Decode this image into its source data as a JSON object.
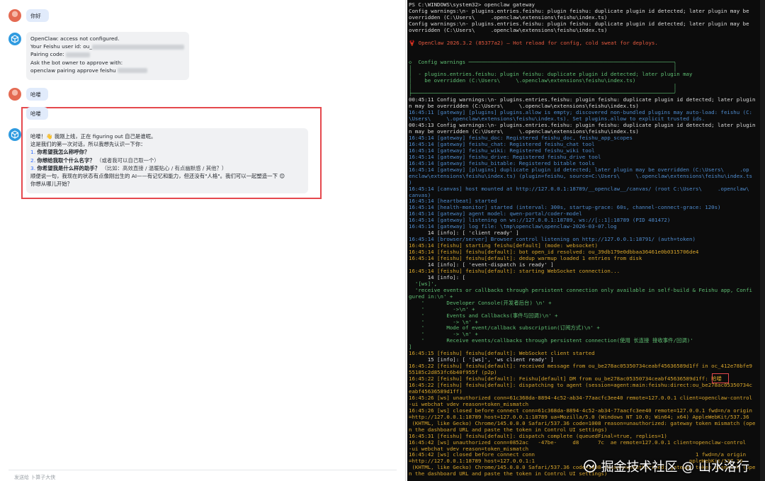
{
  "chat": {
    "messages": [
      {
        "role": "user",
        "text": "你好"
      },
      {
        "role": "bot",
        "lines": [
          "OpenClaw: access not configured.",
          "Your Feishu user id: ou_",
          "Pairing code:",
          "Ask the bot owner to approve with:",
          "openclaw pairing approve feishu"
        ]
      },
      {
        "role": "user",
        "text": "哈喽"
      },
      {
        "role": "user",
        "text": "哈喽"
      },
      {
        "role": "bot",
        "intro": "哈喽！👋 我刚上线，正在 figuring out 自己是谁呢。",
        "intro2": "这是我们的第一次对话，所以我想先认识一下你：",
        "items": [
          {
            "num": "1.",
            "bold": "你希望我怎么称呼你？",
            "sub": ""
          },
          {
            "num": "2.",
            "bold": "你想给我取个什么名字？",
            "sub": "（或者我可以自己取一个）"
          },
          {
            "num": "3.",
            "bold": "你希望我是什么样的助手？",
            "sub": "（比如：高效直接 / 温暖贴心 / 有点幽默感 / 其他？）"
          }
        ],
        "outro": "顺便说一句，我现在的状态有点像刚出生的 AI——有记忆和能力，但还没有\"人格\"。我们可以一起塑造一下 😊",
        "outro2": "你想从哪儿开始？"
      }
    ],
    "composer_placeholder": "发送给 卜算子大侠"
  },
  "terminal": {
    "lines": [
      "PS C:\\WINDOWS\\system32> openclaw gateway",
      "Config warnings:\\n- plugins.entries.feishu: plugin feishu: duplicate plugin id detected; later plugin may be",
      "overridden (C:\\Users\\     .openclaw\\extensions\\feishu\\index.ts)",
      "Config warnings:\\n- plugins.entries.feishu: plugin feishu: duplicate plugin id detected; later plugin may be",
      "overridden (C:\\Users\\     .openclaw\\extensions\\feishu\\index.ts)",
      "",
      "🦞 OpenClaw 2026.3.2 (85377a2) — Hot reload for config, cold sweat for deploys.",
      "",
      "",
      "◇  Config warnings ─────────────────────────────────────────────────────────────────╮",
      "│                                                                                   │",
      "│  - plugins.entries.feishu: plugin feishu: duplicate plugin id detected; later plugin may",
      "│    be overridden (C:\\Users\\     \\.openclaw\\extensions\\feishu\\index.ts)",
      "│                                                                                   │",
      "├───────────────────────────────────────────────────────────────────────────────────╯",
      "00:45:11 Config warnings:\\n- plugins.entries.feishu: plugin feishu: duplicate plugin id detected; later plugin",
      "n may be overridden (C:\\Users\\     \\.openclaw\\extensions\\feishu\\index.ts)",
      "16:45:11 [gateway] [plugins] plugins.allow is empty; discovered non-bundled plugins may auto-load: feishu (C:",
      "\\Users\\     \\.openclaw\\extensions\\feishu\\index.ts). Set plugins.allow to explicit trusted ids.",
      "00:45:13 Config warnings:\\n- plugins.entries.feishu: plugin feishu: duplicate plugin id detected; later plugin",
      "n may be overridden (C:\\Users\\     \\.openclaw\\extensions\\feishu\\index.ts)",
      "16:45:14 [gateway] feishu_doc: Registered feishu_doc, feishu_app_scopes",
      "16:45:14 [gateway] feishu_chat: Registered feishu_chat tool",
      "16:45:14 [gateway] feishu_wiki: Registered feishu_wiki tool",
      "16:45:14 [gateway] feishu_drive: Registered feishu_drive tool",
      "16:45:14 [gateway] feishu_bitable: Registered bitable tools",
      "16:45:14 [gateway] [plugins] duplicate plugin id detected; later plugin may be overridden (C:\\Users\\     .op",
      "enclaw\\extensions\\feishu\\index.ts) (plugin=feishu, source=C:\\Users\\     \\.openclaw\\extensions\\feishu\\index.ts",
      ")",
      "16:45:14 [canvas] host mounted at http://127.0.0.1:18789/__openclaw__/canvas/ (root C:\\Users\\     .openclaw\\",
      "canvas)",
      "16:45:14 [heartbeat] started",
      "16:45:14 [health-monitor] started (interval: 300s, startup-grace: 60s, channel-connect-grace: 120s)",
      "16:45:14 [gateway] agent model: qwen-portal/coder-model",
      "16:45:14 [gateway] listening on ws://127.0.0.1:18789, ws://[::1]:18789 (PID 481472)",
      "16:45:14 [gateway] log file: \\tmp\\openclaw\\openclaw-2026-03-07.log",
      "      14 [info]: [ 'client ready' ]",
      "16:45:14 [browser/server] Browser control listening on http://127.0.0.1:18791/ (auth=token)",
      "16:45:14 [feishu] starting feishu[default] (mode: websocket)",
      "16:45:14 [feishu] feishu[default]: bot open_id resolved: ou_39db179e0dbbaa36461e0b0315706de4",
      "16:45:14 [feishu] feishu[default]: dedup warmup loaded 1 entries from disk",
      "      14 [info]: [ 'event-dispatch is ready' ]",
      "16:45:14 [feishu] feishu[default]: starting WebSocket connection...",
      "      14 [info]: [",
      "  '[ws]',",
      "  'receive events or callbacks through persistent connection only available in self-build & Feishu app, Confi",
      "gured in:\\n' +",
      "    '       Developer Console(开发者后台) \\n' +",
      "    '         ->\\n' +",
      "    '       Events and Callbacks(事件与回调)\\n' +",
      "    '         -> \\n' +",
      "    '       Mode of event/callback subscription(订阅方式)\\n' +",
      "    '         -> \\n' +",
      "    '       Receive events/callbacks through persistent connection(使用 长连接 接收事件/回调)'",
      "]",
      "16:45:15 [feishu] feishu[default]: WebSocket client started",
      "      15 [info]: [ '[ws]', 'ws client ready' ]",
      "16:45:22 [feishu] feishu[default]: received message from ou_be278ac05350734ceabf45636589d1ff in oc_412e78bfe9",
      "55185c2d853fc6b40f955f (p2p)",
      "16:45:22 [feishu] feishu[default]: Feishu[default] DM from ou_be278ac05350734ceabf45636589d1ff: 哈喽",
      "16:45:22 [feishu] feishu[default]: dispatching to agent (session=agent:main:feishu:direct:ou_be278ac05350734c",
      "eabf45636589d1ff)",
      "16:45:26 [ws] unauthorized conn=61c368da-8894-4c52-ab34-77aacfc3ee40 remote=127.0.0.1 client=openclaw-control",
      "-ui webchat vdev reason=token_mismatch",
      "16:45:26 [ws] closed before connect conn=61c368da-8894-4c52-ab34-77aacfc3ee40 remote=127.0.0.1 fwd=n/a origin",
      "=http://127.0.0.1:18789 host=127.0.0.1:18789 ua=Mozilla/5.0 (Windows NT 10.0; Win64; x64) AppleWebKit/537.36",
      " (KHTML, like Gecko) Chrome/145.0.0.0 Safari/537.36 code=1008 reason=unauthorized: gateway token mismatch (ope",
      "n the dashboard URL and paste the token in Control UI settings)",
      "16:45:31 [feishu] feishu[default]: dispatch complete (queuedFinal=true, replies=1)",
      "16:45:42 [ws] unauthorized conn=0852ac   -47be-     d8      7c  ae remote=127.0.0.1 client=openclaw-control",
      "-ui webchat vdev reason=token_mismatch",
      "16:45:42 [ws] closed before connect conn                                                   1 fwd=n/a origin",
      "=http://127.0.0.1:18789 host=127.0.0.1:1                                                 ppleWebKit/537.36",
      " (KHTML, like Gecko) Chrome/145.0.0.0 Safari/537.36 code=1008 reason=unauthorized: gateway token mismatch (ope",
      "n the dashboard URL and paste the token in Control UI settings)"
    ],
    "colors": {
      "background": "#0c0c0c",
      "text": "#cccccc",
      "subsystem_orange": "#d8a52b",
      "gateway_blue": "#4f8ccf",
      "warning_green": "#5fbf73",
      "accent_red": "#e5593f"
    }
  },
  "watermark": {
    "text": "掘金技术社区 @ 山水洛行",
    "icon": "wechat-channel-icon"
  }
}
